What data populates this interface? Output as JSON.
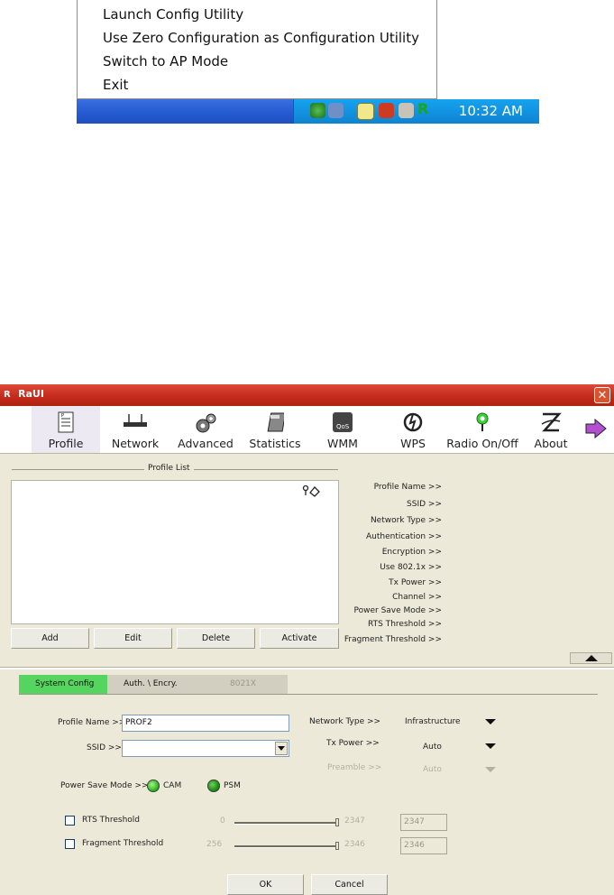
{
  "tray_menu": {
    "items": [
      "Launch Config Utility",
      "Use Zero Configuration as Configuration Utility",
      "Switch to AP Mode",
      "Exit"
    ],
    "clock": "10:32 AM"
  },
  "window": {
    "title": "RaUI",
    "toolbar": [
      "Profile",
      "Network",
      "Advanced",
      "Statistics",
      "WMM",
      "WPS",
      "Radio On/Off",
      "About"
    ],
    "profile_list_title": "Profile List",
    "profile_buttons": [
      "Add",
      "Edit",
      "Delete",
      "Activate"
    ],
    "info_labels": [
      "Profile Name >>",
      "SSID >>",
      "Network Type >>",
      "Authentication >>",
      "Encryption >>",
      "Use 802.1x >>",
      "Tx Power >>",
      "Channel >>",
      "Power Save Mode >>",
      "RTS Threshold >>",
      "Fragment Threshold >>"
    ],
    "tabs": [
      "System Config",
      "Auth. \\ Encry.",
      "8021X"
    ],
    "form": {
      "profile_name_label": "Profile Name >>",
      "profile_name_value": "PROF2",
      "ssid_label": "SSID >>",
      "ssid_value": "",
      "network_type_label": "Network Type >>",
      "network_type_value": "Infrastructure",
      "tx_power_label": "Tx Power >>",
      "tx_power_value": "Auto",
      "preamble_label": "Preamble >>",
      "preamble_value": "Auto",
      "power_save_label": "Power Save Mode >>",
      "power_save_options": [
        "CAM",
        "PSM"
      ],
      "rts_label": "RTS Threshold",
      "rts_min": "0",
      "rts_max": "2347",
      "rts_value": "2347",
      "frag_label": "Fragment Threshold",
      "frag_min": "256",
      "frag_max": "2346",
      "frag_value": "2346"
    },
    "ok_label": "OK",
    "cancel_label": "Cancel"
  }
}
